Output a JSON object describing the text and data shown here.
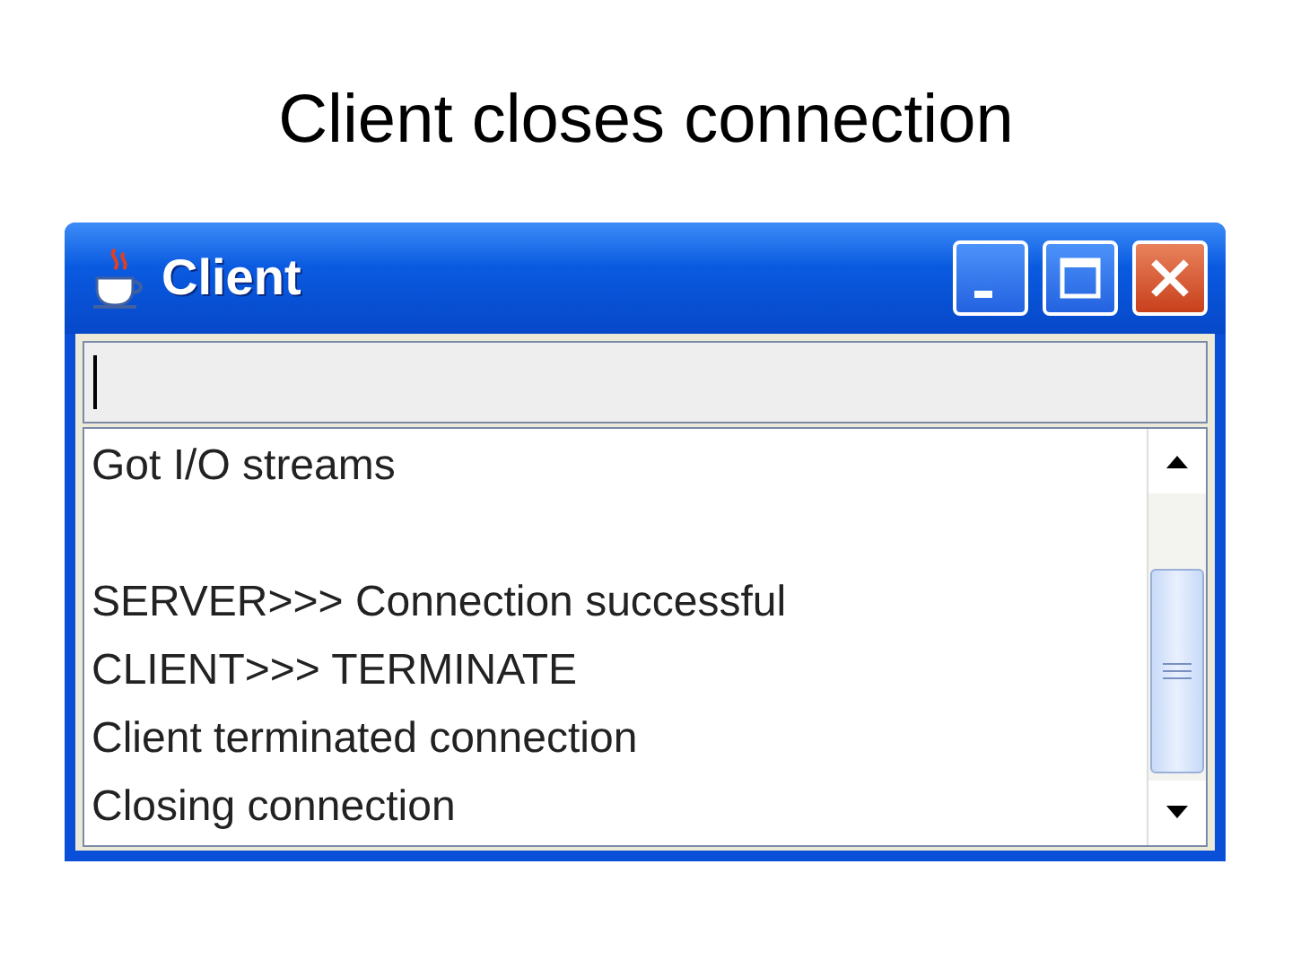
{
  "slide": {
    "title": "Client closes connection"
  },
  "window": {
    "title": "Client"
  },
  "input": {
    "focused": true
  },
  "log": {
    "lines": [
      {
        "text": "Got I/O streams",
        "blank_line_before": false
      },
      {
        "text": "SERVER>>> Connection successful",
        "blank_line_before": true
      },
      {
        "text": "CLIENT>>> TERMINATE",
        "blank_line_before": false
      },
      {
        "text": "Client terminated connection",
        "blank_line_before": false
      },
      {
        "text": "Closing connection",
        "blank_line_before": false
      }
    ]
  }
}
